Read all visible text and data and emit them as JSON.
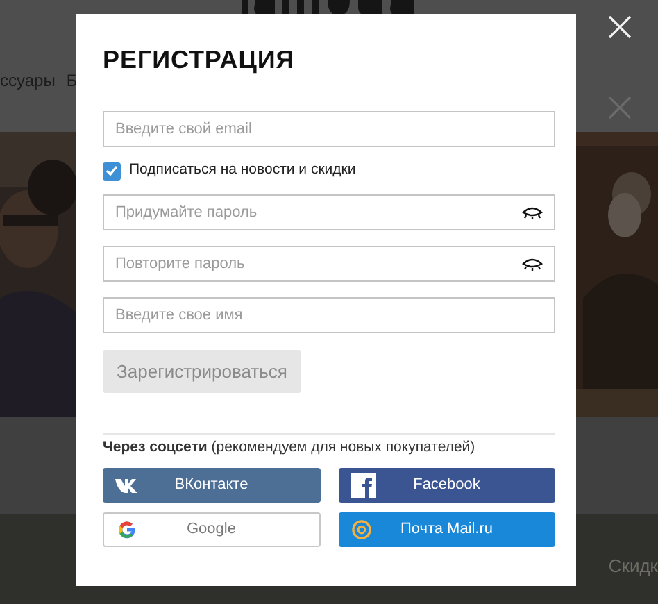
{
  "page": {
    "nav": [
      "ссуары",
      "Б"
    ],
    "promo_text": "Скидк"
  },
  "modal": {
    "title": "РЕГИСТРАЦИЯ",
    "fields": [
      {
        "kind": "text",
        "placeholder": "Введите свой email"
      },
      {
        "kind": "checkbox",
        "label": "Подписаться на новости и скидки",
        "checked": true
      },
      {
        "kind": "password",
        "placeholder": "Придумайте пароль"
      },
      {
        "kind": "password",
        "placeholder": "Повторите пароль"
      },
      {
        "kind": "text",
        "placeholder": "Введите свое имя"
      }
    ],
    "submit": {
      "label": "Зарегистрироваться",
      "disabled": true
    },
    "social_note": "**Через соцсети** (рекомендуем для новых покупателей)",
    "social_buttons": [
      {
        "kind": "vk",
        "label": "ВКонтакте"
      },
      {
        "kind": "facebook",
        "label": "Facebook"
      },
      {
        "kind": "google",
        "label": "Google"
      },
      {
        "kind": "mail",
        "label": "Почта Mail.ru"
      }
    ]
  }
}
